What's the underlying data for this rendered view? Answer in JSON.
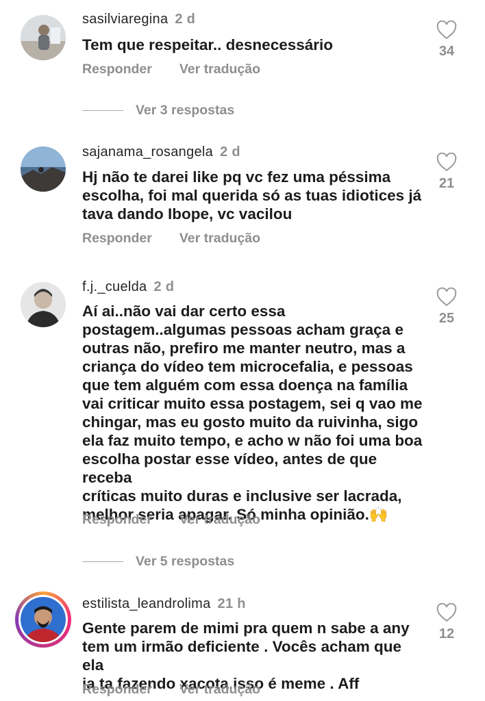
{
  "comments": [
    {
      "username": "sasilviaregina",
      "time": "2 d",
      "text": "Tem que respeitar.. desnecessário",
      "reply_label": "Responder",
      "translate_label": "Ver tradução",
      "likes": "34",
      "avatar": "avatar-photo"
    },
    {
      "username": "sajanama_rosangela",
      "time": "2 d",
      "text": "Hj não te darei like pq vc fez uma péssima\nescolha, foi mal querida só as tuas idiotices já\ntava dando Ibope, vc vacilou",
      "reply_label": "Responder",
      "translate_label": "Ver tradução",
      "likes": "21",
      "avatar": "avatar-photo"
    },
    {
      "username": "f.j._cuelda",
      "time": "2 d",
      "text": "Aí ai..não vai dar certo essa\npostagem..algumas pessoas acham graça e\noutras não, prefiro me manter neutro, mas a\ncriança do vídeo tem microcefalia, e pessoas\nque tem alguém com essa doença na família\nvai criticar muito essa postagem, sei q vao me\nchingar, mas eu gosto muito da ruivinha, sigo\nela faz muito tempo, e acho w não foi uma boa\nescolha postar esse vídeo, antes de que receba\ncríticas muito duras e inclusive ser lacrada,\nmelhor seria apagar. Só minha opinião.🙌",
      "reply_label": "Responder",
      "translate_label": "Ver tradução",
      "likes": "25",
      "avatar": "avatar-photo"
    },
    {
      "username": "estilista_leandrolima",
      "time": "21 h",
      "text": "Gente parem de mimi pra quem n sabe a any\ntem um irmão deficiente . Vocês acham que ela\nia ta fazendo xacota isso é meme . Aff",
      "reply_label": "Responder",
      "translate_label": "Ver tradução",
      "likes": "12",
      "avatar": "avatar-photo-with-story-ring"
    }
  ],
  "reply_threads": [
    {
      "label": "Ver 3 respostas"
    },
    {
      "label": "Ver 5 respostas"
    }
  ],
  "colors": {
    "text": "#1c1c1c",
    "muted": "#8e8e8e",
    "story_ring": "#ee2a7b"
  }
}
